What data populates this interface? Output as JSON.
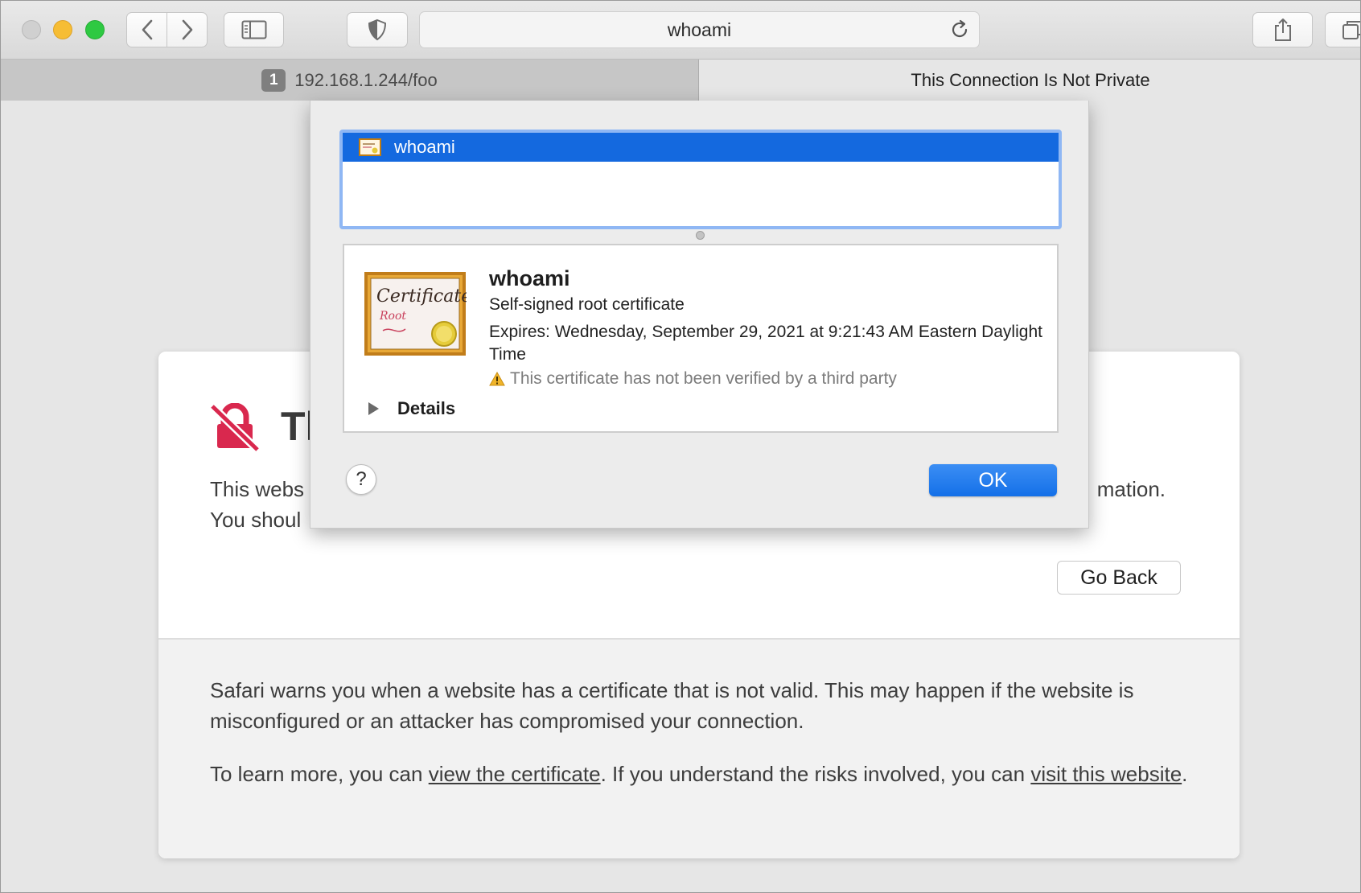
{
  "toolbar": {
    "address_text": "whoami"
  },
  "tabs": [
    {
      "number": "1",
      "label": "192.168.1.244/foo"
    },
    {
      "label": "This Connection Is Not Private"
    }
  ],
  "warning_page": {
    "title_fragment": "Th",
    "text_visible_left_line1": "This webs",
    "text_visible_right_line1": "mation.",
    "text_visible_left_line2": "You shoul",
    "go_back_label": "Go Back",
    "explanation": "Safari warns you when a website has a certificate that is not valid. This may happen if the website is misconfigured or an attacker has compromised your connection.",
    "learn_more_prefix": "To learn more, you can ",
    "view_certificate_link": "view the certificate",
    "learn_more_middle": ". If you understand the risks involved, you can ",
    "visit_website_link": "visit this website",
    "learn_more_suffix": "."
  },
  "certificate_sheet": {
    "list_items": [
      {
        "label": "whoami",
        "selected": true
      }
    ],
    "cert_name": "whoami",
    "cert_kind": "Self-signed root certificate",
    "cert_expires": "Expires: Wednesday, September 29, 2021 at 9:21:43 AM Eastern Daylight Time",
    "cert_warning": "This certificate has not been verified by a third party",
    "details_label": "Details",
    "help_label": "?",
    "ok_label": "OK",
    "cert_image_text_1": "Certificate",
    "cert_image_text_2": "Root"
  },
  "colors": {
    "selection_blue": "#1469df",
    "ok_blue": "#1470e8",
    "danger_red": "#d9284e"
  }
}
